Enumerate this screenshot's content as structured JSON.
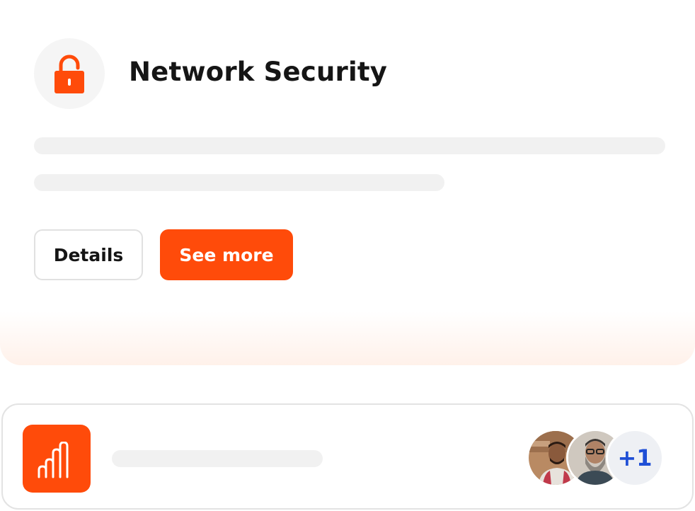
{
  "card": {
    "title": "Network Security",
    "icon": "lock-icon",
    "buttons": {
      "details_label": "Details",
      "see_more_label": "See more"
    }
  },
  "footer": {
    "icon": "bar-chart-icon",
    "avatars": [
      {
        "name": "person-avatar-1"
      },
      {
        "name": "person-avatar-2"
      }
    ],
    "extra_count": "+1"
  },
  "colors": {
    "accent": "#ff4b0a",
    "skeleton": "#f1f1f1",
    "count_text": "#1f4fd6"
  }
}
